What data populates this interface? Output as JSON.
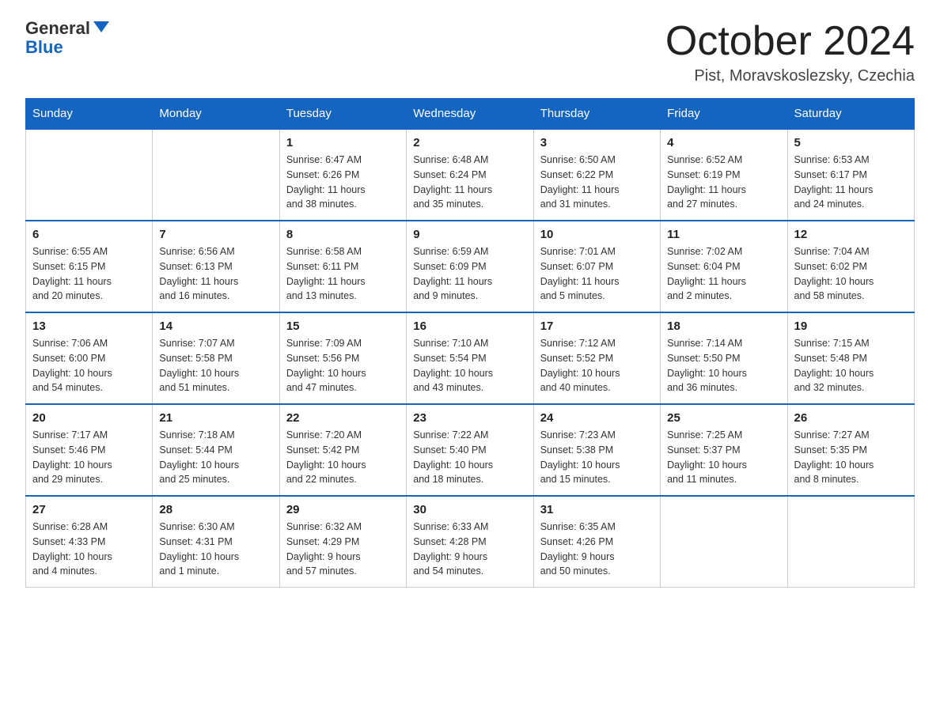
{
  "header": {
    "logo_general": "General",
    "logo_blue": "Blue",
    "month_title": "October 2024",
    "location": "Pist, Moravskoslezsky, Czechia"
  },
  "days_of_week": [
    "Sunday",
    "Monday",
    "Tuesday",
    "Wednesday",
    "Thursday",
    "Friday",
    "Saturday"
  ],
  "weeks": [
    [
      {
        "day": "",
        "info": ""
      },
      {
        "day": "",
        "info": ""
      },
      {
        "day": "1",
        "info": "Sunrise: 6:47 AM\nSunset: 6:26 PM\nDaylight: 11 hours\nand 38 minutes."
      },
      {
        "day": "2",
        "info": "Sunrise: 6:48 AM\nSunset: 6:24 PM\nDaylight: 11 hours\nand 35 minutes."
      },
      {
        "day": "3",
        "info": "Sunrise: 6:50 AM\nSunset: 6:22 PM\nDaylight: 11 hours\nand 31 minutes."
      },
      {
        "day": "4",
        "info": "Sunrise: 6:52 AM\nSunset: 6:19 PM\nDaylight: 11 hours\nand 27 minutes."
      },
      {
        "day": "5",
        "info": "Sunrise: 6:53 AM\nSunset: 6:17 PM\nDaylight: 11 hours\nand 24 minutes."
      }
    ],
    [
      {
        "day": "6",
        "info": "Sunrise: 6:55 AM\nSunset: 6:15 PM\nDaylight: 11 hours\nand 20 minutes."
      },
      {
        "day": "7",
        "info": "Sunrise: 6:56 AM\nSunset: 6:13 PM\nDaylight: 11 hours\nand 16 minutes."
      },
      {
        "day": "8",
        "info": "Sunrise: 6:58 AM\nSunset: 6:11 PM\nDaylight: 11 hours\nand 13 minutes."
      },
      {
        "day": "9",
        "info": "Sunrise: 6:59 AM\nSunset: 6:09 PM\nDaylight: 11 hours\nand 9 minutes."
      },
      {
        "day": "10",
        "info": "Sunrise: 7:01 AM\nSunset: 6:07 PM\nDaylight: 11 hours\nand 5 minutes."
      },
      {
        "day": "11",
        "info": "Sunrise: 7:02 AM\nSunset: 6:04 PM\nDaylight: 11 hours\nand 2 minutes."
      },
      {
        "day": "12",
        "info": "Sunrise: 7:04 AM\nSunset: 6:02 PM\nDaylight: 10 hours\nand 58 minutes."
      }
    ],
    [
      {
        "day": "13",
        "info": "Sunrise: 7:06 AM\nSunset: 6:00 PM\nDaylight: 10 hours\nand 54 minutes."
      },
      {
        "day": "14",
        "info": "Sunrise: 7:07 AM\nSunset: 5:58 PM\nDaylight: 10 hours\nand 51 minutes."
      },
      {
        "day": "15",
        "info": "Sunrise: 7:09 AM\nSunset: 5:56 PM\nDaylight: 10 hours\nand 47 minutes."
      },
      {
        "day": "16",
        "info": "Sunrise: 7:10 AM\nSunset: 5:54 PM\nDaylight: 10 hours\nand 43 minutes."
      },
      {
        "day": "17",
        "info": "Sunrise: 7:12 AM\nSunset: 5:52 PM\nDaylight: 10 hours\nand 40 minutes."
      },
      {
        "day": "18",
        "info": "Sunrise: 7:14 AM\nSunset: 5:50 PM\nDaylight: 10 hours\nand 36 minutes."
      },
      {
        "day": "19",
        "info": "Sunrise: 7:15 AM\nSunset: 5:48 PM\nDaylight: 10 hours\nand 32 minutes."
      }
    ],
    [
      {
        "day": "20",
        "info": "Sunrise: 7:17 AM\nSunset: 5:46 PM\nDaylight: 10 hours\nand 29 minutes."
      },
      {
        "day": "21",
        "info": "Sunrise: 7:18 AM\nSunset: 5:44 PM\nDaylight: 10 hours\nand 25 minutes."
      },
      {
        "day": "22",
        "info": "Sunrise: 7:20 AM\nSunset: 5:42 PM\nDaylight: 10 hours\nand 22 minutes."
      },
      {
        "day": "23",
        "info": "Sunrise: 7:22 AM\nSunset: 5:40 PM\nDaylight: 10 hours\nand 18 minutes."
      },
      {
        "day": "24",
        "info": "Sunrise: 7:23 AM\nSunset: 5:38 PM\nDaylight: 10 hours\nand 15 minutes."
      },
      {
        "day": "25",
        "info": "Sunrise: 7:25 AM\nSunset: 5:37 PM\nDaylight: 10 hours\nand 11 minutes."
      },
      {
        "day": "26",
        "info": "Sunrise: 7:27 AM\nSunset: 5:35 PM\nDaylight: 10 hours\nand 8 minutes."
      }
    ],
    [
      {
        "day": "27",
        "info": "Sunrise: 6:28 AM\nSunset: 4:33 PM\nDaylight: 10 hours\nand 4 minutes."
      },
      {
        "day": "28",
        "info": "Sunrise: 6:30 AM\nSunset: 4:31 PM\nDaylight: 10 hours\nand 1 minute."
      },
      {
        "day": "29",
        "info": "Sunrise: 6:32 AM\nSunset: 4:29 PM\nDaylight: 9 hours\nand 57 minutes."
      },
      {
        "day": "30",
        "info": "Sunrise: 6:33 AM\nSunset: 4:28 PM\nDaylight: 9 hours\nand 54 minutes."
      },
      {
        "day": "31",
        "info": "Sunrise: 6:35 AM\nSunset: 4:26 PM\nDaylight: 9 hours\nand 50 minutes."
      },
      {
        "day": "",
        "info": ""
      },
      {
        "day": "",
        "info": ""
      }
    ]
  ]
}
